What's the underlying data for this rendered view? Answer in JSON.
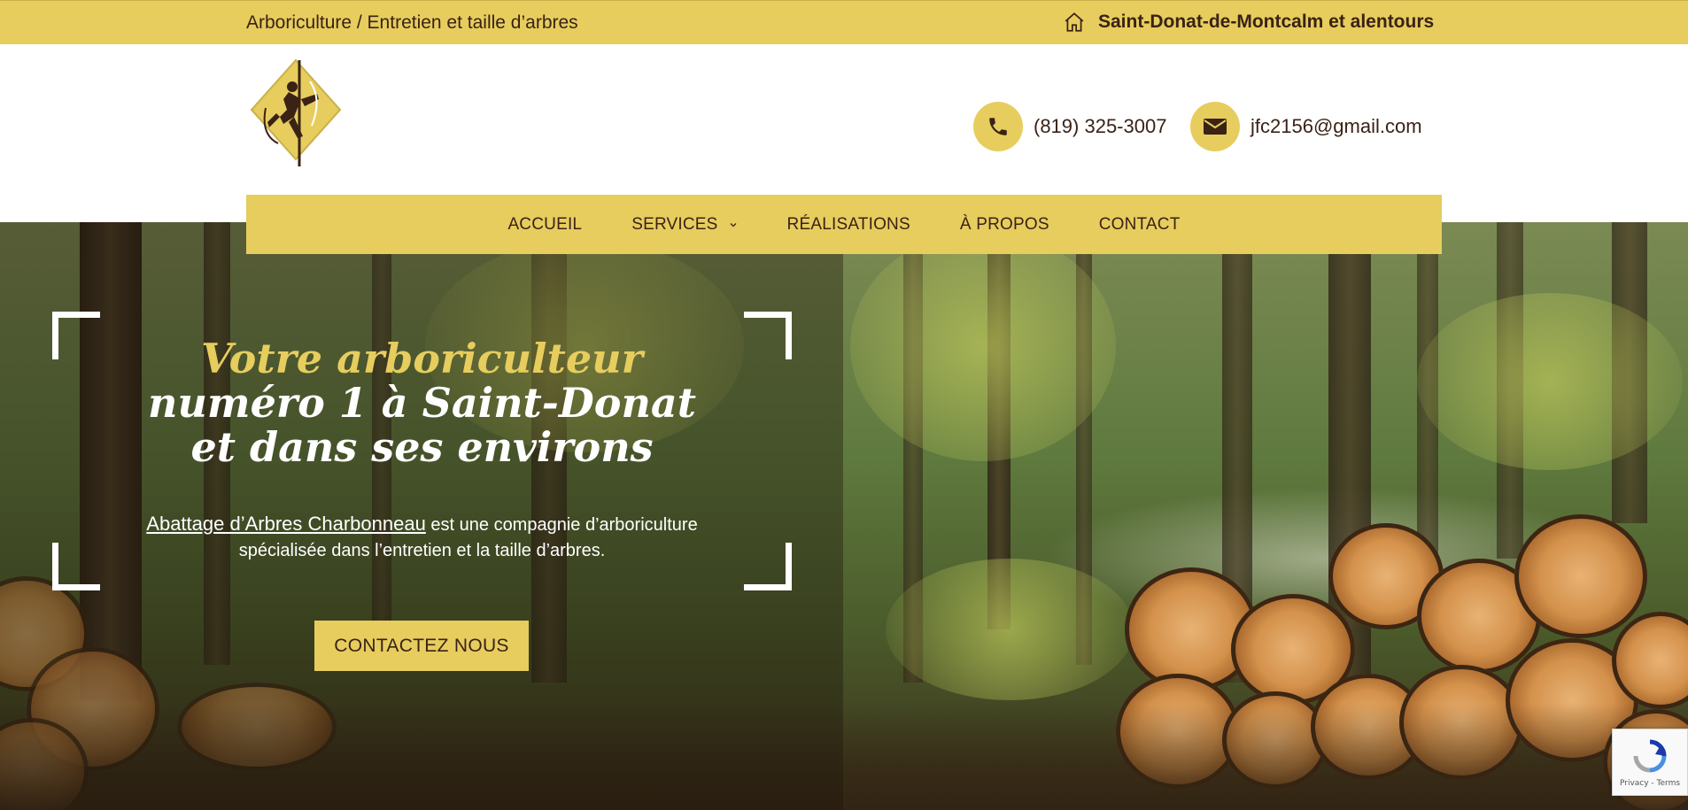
{
  "topbar": {
    "tagline": "Arboriculture / Entretien et taille d’arbres",
    "location": "Saint-Donat-de-Montcalm et alentours",
    "location_icon": "home-icon"
  },
  "header": {
    "logo_icon": "arborist-climber-logo",
    "phone": "(819) 325-3007",
    "phone_icon": "phone-icon",
    "email": "jfc2156@gmail.com",
    "email_icon": "envelope-icon"
  },
  "nav": {
    "items": [
      {
        "label": "ACCUEIL"
      },
      {
        "label": "SERVICES",
        "has_dropdown": true
      },
      {
        "label": "RÉALISATIONS"
      },
      {
        "label": "À PROPOS"
      },
      {
        "label": "CONTACT"
      }
    ]
  },
  "hero": {
    "title_line1": "Votre arboriculteur",
    "title_line2": "numéro 1 à Saint-Donat",
    "title_line3": "et dans ses environs",
    "company_name": "Abattage d’Arbres Charbonneau",
    "description_rest": " est une compagnie d’arboriculture spécialisée dans l’entretien et la taille d’arbres.",
    "cta_label": "CONTACTEZ NOUS"
  },
  "recaptcha": {
    "text": "Privacy - Terms"
  },
  "colors": {
    "accent": "#e6cd5e",
    "text_dark": "#3a2215",
    "white": "#ffffff"
  }
}
